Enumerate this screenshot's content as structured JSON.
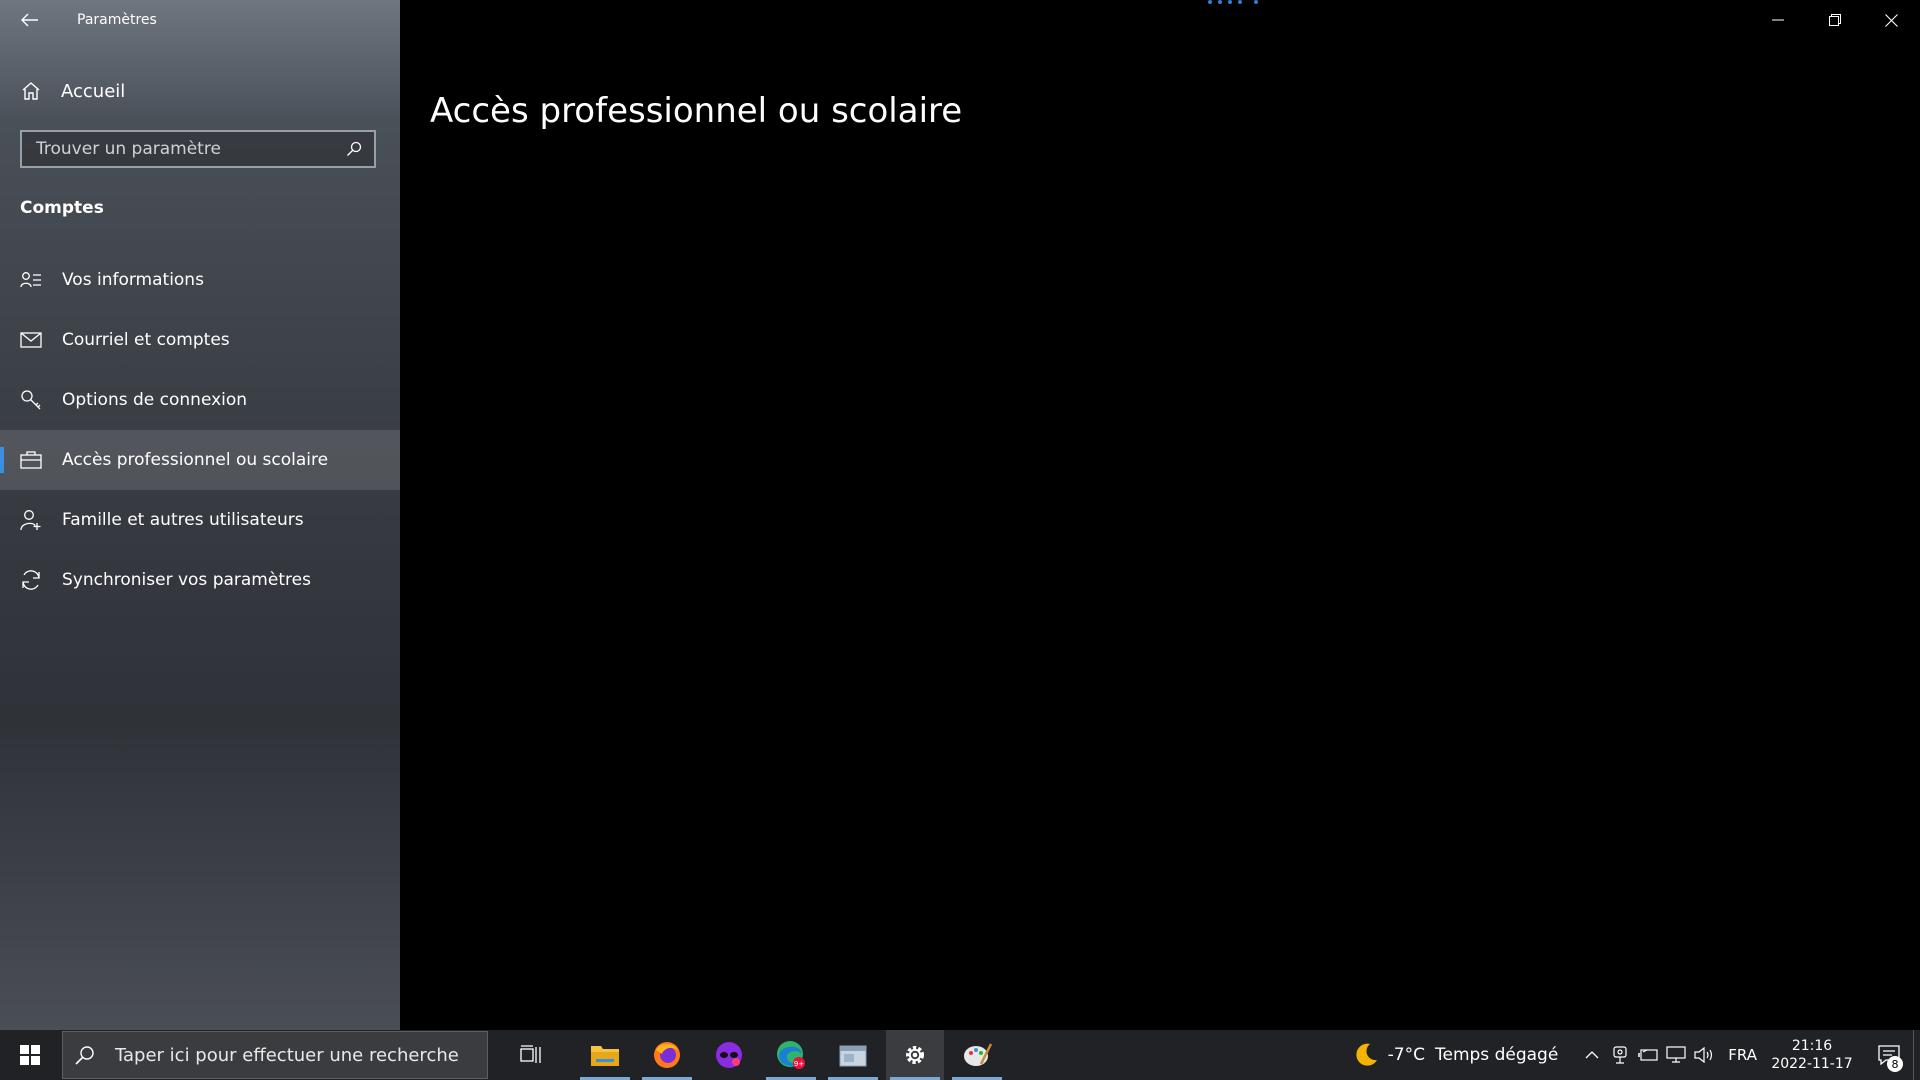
{
  "app": {
    "title": "Paramètres"
  },
  "sidebar": {
    "home_label": "Accueil",
    "search_placeholder": "Trouver un paramètre",
    "section_title": "Comptes",
    "items": [
      {
        "label": "Vos informations",
        "icon": "person-info-icon"
      },
      {
        "label": "Courriel et comptes",
        "icon": "mail-icon"
      },
      {
        "label": "Options de connexion",
        "icon": "key-icon"
      },
      {
        "label": "Accès professionnel ou scolaire",
        "icon": "briefcase-icon",
        "active": true
      },
      {
        "label": "Famille et autres utilisateurs",
        "icon": "person-add-icon"
      },
      {
        "label": "Synchroniser vos paramètres",
        "icon": "sync-icon"
      }
    ]
  },
  "main": {
    "page_title": "Accès professionnel ou scolaire"
  },
  "taskbar": {
    "search_placeholder": "Taper ici pour effectuer une recherche",
    "apps": [
      "task-view",
      "file-explorer",
      "firefox",
      "app-mask",
      "edge",
      "app-window",
      "settings",
      "paint"
    ],
    "weather": {
      "temp": "-7°C",
      "condition": "Temps dégagé"
    },
    "language": "FRA",
    "time": "21:16",
    "date": "2022-11-17",
    "notifications_count": "8"
  },
  "colors": {
    "accent": "#3a8fe0",
    "taskbar": "#202226"
  }
}
